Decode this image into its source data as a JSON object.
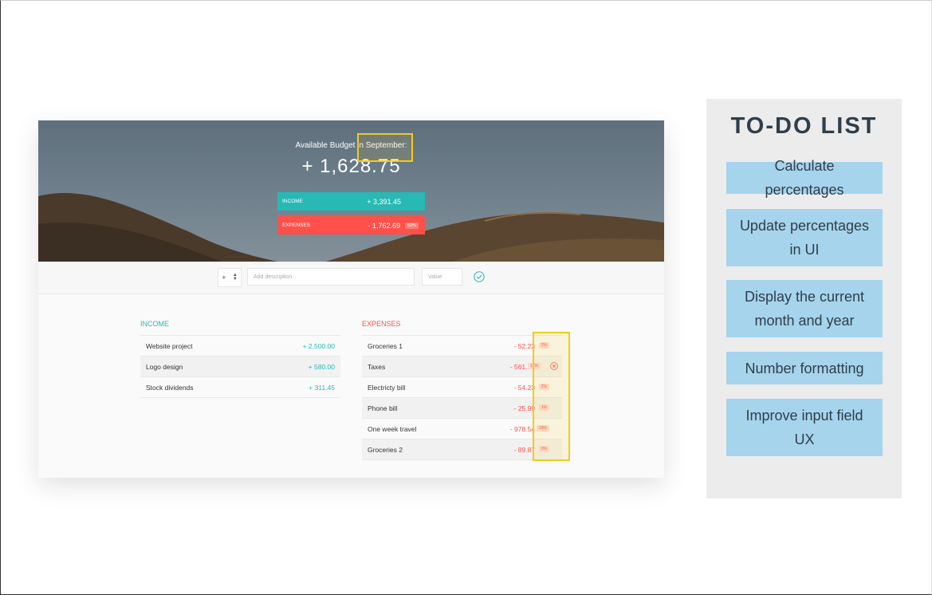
{
  "app": {
    "header": {
      "budget_title": "Available Budget in September:",
      "budget_value": "+ 1,628.75",
      "income_label": "INCOME",
      "income_value": "+ 3,391.45",
      "expenses_label": "EXPENSES",
      "expenses_value": "- 1,762.69",
      "expenses_percentage": "52%"
    },
    "add_bar": {
      "type_value": "+",
      "description_placeholder": "Add description",
      "value_placeholder": "Value"
    },
    "income": {
      "title": "INCOME",
      "items": [
        {
          "description": "Website project",
          "value": "+ 2,500.00"
        },
        {
          "description": "Logo design",
          "value": "+ 580.00"
        },
        {
          "description": "Stock dividends",
          "value": "+ 311.45"
        }
      ]
    },
    "expenses": {
      "title": "EXPENSES",
      "items": [
        {
          "description": "Groceries 1",
          "value": "- 52.23",
          "percentage": "2%"
        },
        {
          "description": "Taxes",
          "value": "- 561.87",
          "percentage": "17%"
        },
        {
          "description": "Electricty bill",
          "value": "- 54.23",
          "percentage": "2%"
        },
        {
          "description": "Phone bill",
          "value": "- 25.99",
          "percentage": "1%"
        },
        {
          "description": "One week travel",
          "value": "- 978.54",
          "percentage": "29%"
        },
        {
          "description": "Groceries 2",
          "value": "- 89.87",
          "percentage": "3%"
        }
      ]
    },
    "colors": {
      "income": "#28b9b5",
      "expenses": "#ff5049",
      "highlight": "#f2cb1d"
    }
  },
  "todo": {
    "title": "TO-DO LIST",
    "tasks": [
      "Calculate percentages",
      "Update percentages in UI",
      "Display the current month and year",
      "Number formatting",
      "Improve input field UX"
    ],
    "colors": {
      "panel": "#ececec",
      "task": "#a6d4ec",
      "text": "#2f3e4a"
    }
  }
}
